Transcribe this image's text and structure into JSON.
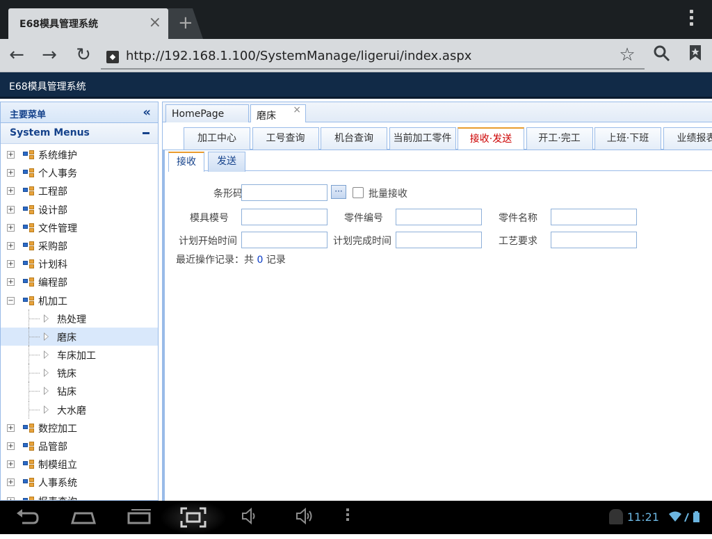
{
  "browser": {
    "tab_title": "E68模具管理系统",
    "tab_close": "×",
    "new_tab": "+",
    "url": "http://192.168.1.100/SystemManage/ligerui/index.aspx"
  },
  "app": {
    "title": "E68模具管理系统"
  },
  "left_panel": {
    "header": "主要菜单",
    "collapse_glyph": "«",
    "section": "System Menus",
    "tree": [
      {
        "label": "系统维护",
        "expanded": false
      },
      {
        "label": "个人事务",
        "expanded": false
      },
      {
        "label": "工程部",
        "expanded": false
      },
      {
        "label": "设计部",
        "expanded": false
      },
      {
        "label": "文件管理",
        "expanded": false
      },
      {
        "label": "采购部",
        "expanded": false
      },
      {
        "label": "计划科",
        "expanded": false
      },
      {
        "label": "编程部",
        "expanded": false
      },
      {
        "label": "机加工",
        "expanded": true
      }
    ],
    "children": [
      "热处理",
      "磨床",
      "车床加工",
      "铣床",
      "钻床",
      "大水磨"
    ],
    "selected_child": "磨床",
    "tree_after": [
      {
        "label": "数控加工"
      },
      {
        "label": "品管部"
      },
      {
        "label": "制模组立"
      },
      {
        "label": "人事系统"
      },
      {
        "label": "报表查询"
      }
    ]
  },
  "page_tabs": [
    {
      "label": "HomePage",
      "closable": false
    },
    {
      "label": "磨床",
      "closable": true
    }
  ],
  "page_tab_close": "×",
  "nav_tabs": [
    "加工中心",
    "工号查询",
    "机台查询",
    "当前加工零件",
    "接收·发送",
    "开工·完工",
    "上班·下班",
    "业绩报表"
  ],
  "nav_tabs_active": "接收·发送",
  "sub_tabs": [
    "接收",
    "发送"
  ],
  "sub_tabs_active": "接收",
  "form": {
    "barcode_label": "条形码",
    "browse_glyph": "···",
    "batch_label": "批量接收",
    "mold_no_label": "模具模号",
    "part_no_label": "零件编号",
    "part_name_label": "零件名称",
    "plan_start_label": "计划开始时间",
    "plan_end_label": "计划完成时间",
    "process_req_label": "工艺要求",
    "record_prefix": "最近操作记录：共",
    "record_count": "0",
    "record_suffix": "记录"
  },
  "status_bar": {
    "time": "11:21"
  }
}
